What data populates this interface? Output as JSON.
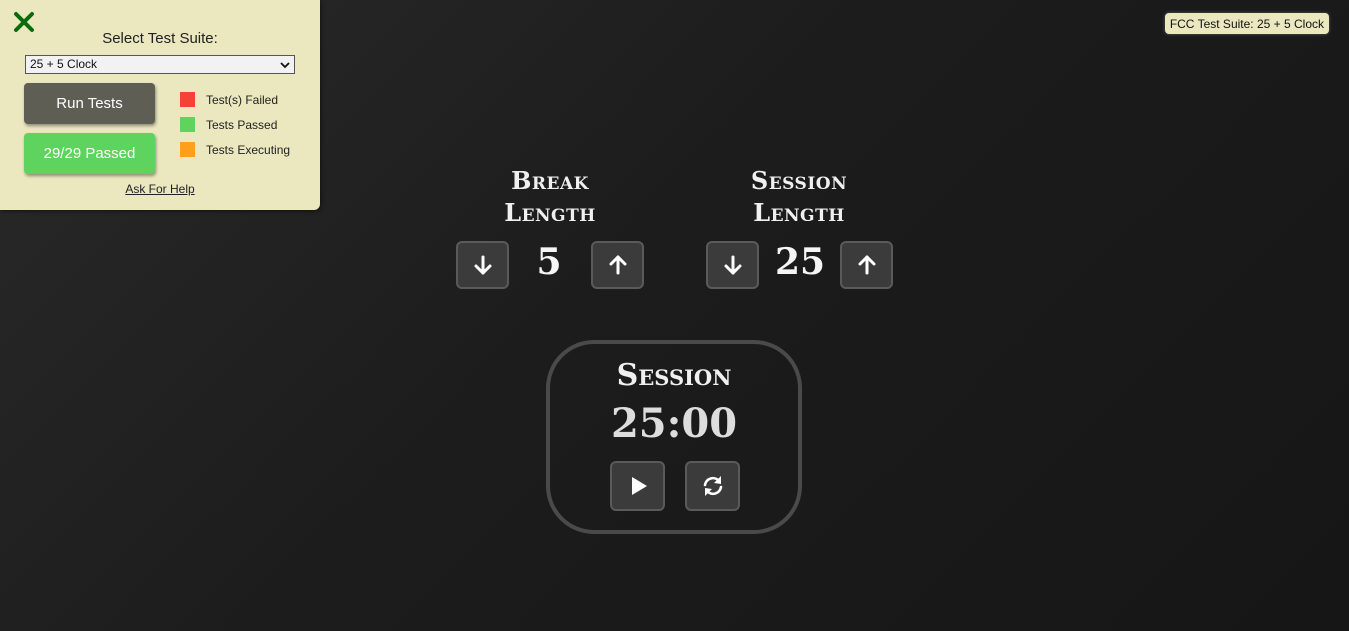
{
  "fcc": {
    "title": "Select Test Suite:",
    "selected_suite": "25 + 5 Clock",
    "run_button": "Run Tests",
    "result_button": "29/29 Passed",
    "legend": [
      {
        "label": "Test(s) Failed",
        "color": "#f44336"
      },
      {
        "label": "Tests Passed",
        "color": "#5ed35e"
      },
      {
        "label": "Tests Executing",
        "color": "#ff9f1a"
      }
    ],
    "help_link": "Ask For Help",
    "badge": "FCC Test Suite: 25 + 5 Clock",
    "close_icon": "close-icon"
  },
  "clock": {
    "break_label_line1": "Break",
    "break_label_line2": "Length",
    "session_label_line1": "Session",
    "session_label_line2": "Length",
    "break_length": "5",
    "session_length": "25",
    "timer_label": "Session",
    "time_left": "25:00",
    "icons": {
      "decrement": "arrow-down-icon",
      "increment": "arrow-up-icon",
      "start_stop": "play-icon",
      "reset": "refresh-icon"
    }
  },
  "colors": {
    "panel_bg": "#ebe8c0",
    "run_button_bg": "#5f5e55",
    "passed_button_bg": "#5ed35e",
    "close_icon": "#0a6b0a",
    "page_bg": "#1e1e1e"
  }
}
